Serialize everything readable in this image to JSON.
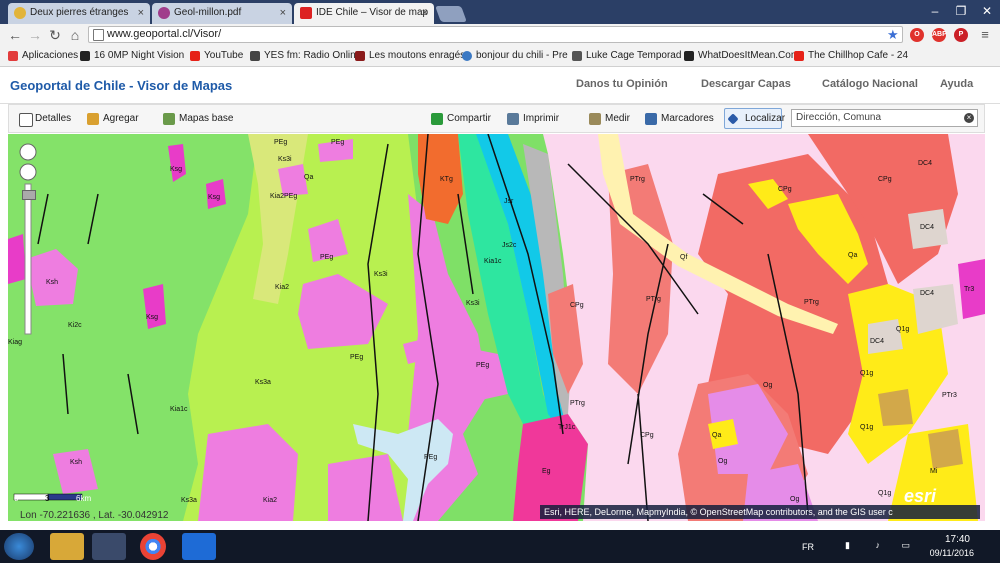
{
  "tabs": [
    {
      "label": "Deux pierres étranges",
      "active": false
    },
    {
      "label": "Geol-millon.pdf",
      "active": false
    },
    {
      "label": "IDE Chile – Visor de map",
      "active": true
    }
  ],
  "address": {
    "url": "www.geoportal.cl/Visor/"
  },
  "bookmarks": [
    {
      "label": "Aplicaciones",
      "color": "#e23c3c"
    },
    {
      "label": "16 0MP Night Vision",
      "color": "#222222"
    },
    {
      "label": "YouTube",
      "color": "#e62117"
    },
    {
      "label": "YES fm: Radio Online",
      "color": "#444444"
    },
    {
      "label": "Les moutons enragés",
      "color": "#8a1a1a"
    },
    {
      "label": "bonjour du chili - Pre",
      "color": "#3a78c3"
    },
    {
      "label": "Luke Cage Temporad",
      "color": "#555555"
    },
    {
      "label": "WhatDoesItMean.Com",
      "color": "#222222"
    },
    {
      "label": "The Chillhop Cafe - 24",
      "color": "#e62117"
    }
  ],
  "app": {
    "title": "Geoportal de Chile - Visor de Mapas",
    "nav": [
      "Danos tu Opinión",
      "Descargar Capas",
      "Catálogo Nacional",
      "Ayuda"
    ]
  },
  "toolbar": {
    "detalles": "Detalles",
    "agregar": "Agregar",
    "mapas_base": "Mapas base",
    "compartir": "Compartir",
    "imprimir": "Imprimir",
    "medir": "Medir",
    "marcadores": "Marcadores",
    "localizar": "Localizar",
    "search_value": "Dirección, Comuna"
  },
  "map": {
    "labels": [
      "Ksg",
      "Ksg",
      "Ksg",
      "Ksh",
      "Ksh",
      "Ki2c",
      "Kiag",
      "Kia1c",
      "Ks3a",
      "Ks3a",
      "Ks3i",
      "Ks3i",
      "Ks3i",
      "Kia2",
      "Kia2",
      "Kia2PEg",
      "Qa",
      "PEg",
      "PEg",
      "PEg",
      "PEg",
      "PEg",
      "PEg",
      "KTg",
      "Jsr",
      "Js2c",
      "Kia1c",
      "TrJ1c",
      "PTrg",
      "PTrg",
      "PTrg",
      "PTrg",
      "CPg",
      "CPg",
      "CPg",
      "CPg",
      "Qf",
      "Qa",
      "Qa",
      "Og",
      "Og",
      "Og",
      "Eg",
      "DC4",
      "DC4",
      "DC4",
      "DC4",
      "Q1g",
      "Q1g",
      "Q1g",
      "Q1g",
      "Mi",
      "Tr3",
      "PTr3"
    ],
    "scale": {
      "zero": "0",
      "mid": "3",
      "end": "6km"
    },
    "attribution": "Esri, HERE, DeLorme, MapmyIndia, © OpenStreetMap contributors, and the GIS user c",
    "esri_logo": "esri",
    "coords": "Lon -70.221636 , Lat. -30.042912"
  },
  "tray": {
    "lang": "FR",
    "time": "17:40",
    "date": "09/11/2016"
  }
}
